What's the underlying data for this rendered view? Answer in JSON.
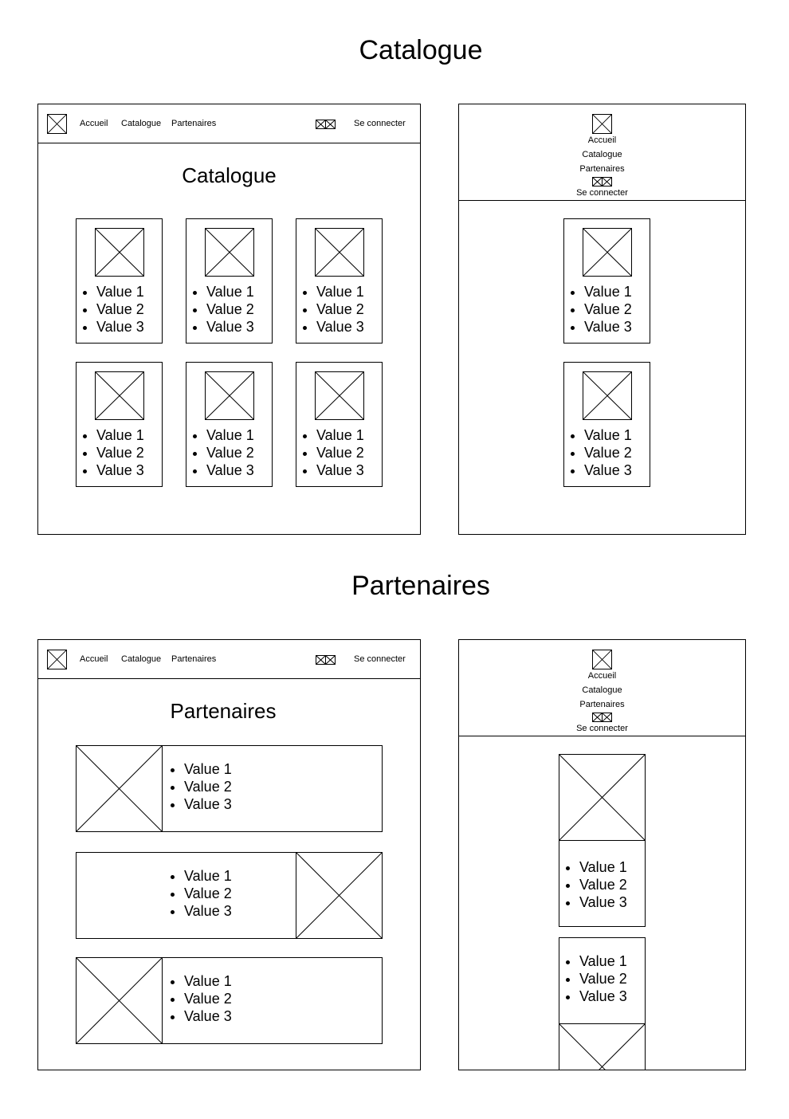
{
  "sections": {
    "catalogue_title": "Catalogue",
    "partenaires_title": "Partenaires"
  },
  "nav": {
    "accueil": "Accueil",
    "catalogue": "Catalogue",
    "partenaires": "Partenaires",
    "login": "Se connecter"
  },
  "catalogue_page": {
    "heading": "Catalogue",
    "items": [
      "Value 1",
      "Value 2",
      "Value 3"
    ]
  },
  "partenaires_page": {
    "heading": "Partenaires",
    "items": [
      "Value 1",
      "Value 2",
      "Value 3"
    ]
  },
  "icons": {
    "logo": "image-placeholder-icon",
    "cart": "double-image-placeholder-icon",
    "image": "image-placeholder-icon"
  }
}
